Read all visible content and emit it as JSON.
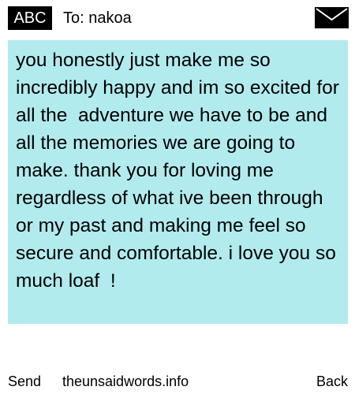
{
  "header": {
    "input_mode": "ABC",
    "to_line": "To: nakoa",
    "mail_icon": "envelope-icon"
  },
  "message": {
    "body": "you honestly just make me so incredibly happy and im so excited for all the  adventure we have to be and all the memories we are going to make. thank you for loving me regardless of what ive been through or my past and making me feel so secure and comfortable. i love you so much loaf  !",
    "background": "#b2ebee"
  },
  "footer": {
    "send_label": "Send",
    "site_label": "theunsaidwords.info",
    "back_label": "Back"
  }
}
